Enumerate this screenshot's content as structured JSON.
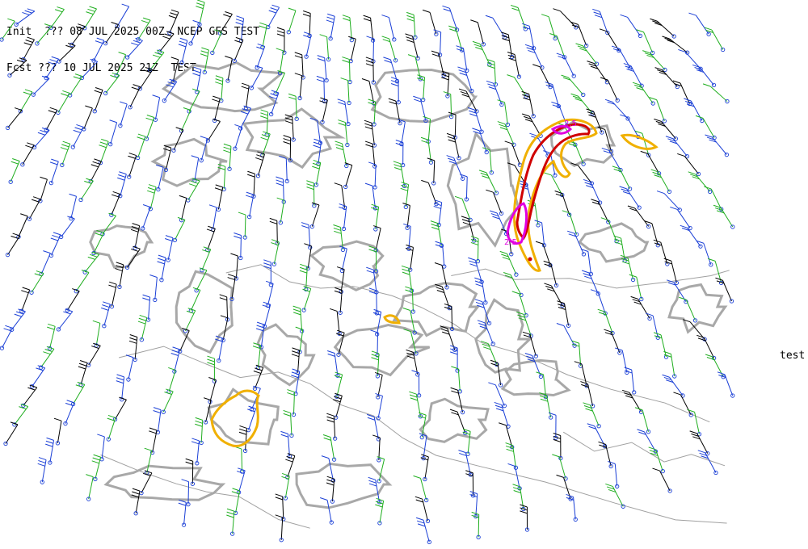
{
  "header": {
    "init_line": "Init  ??? 08 JUL 2025 00Z  NCEP GFS TEST",
    "fcst_line": "Fcst ??? 10 JUL 2025 21Z  TEST"
  },
  "side_label": "test",
  "map": {
    "projection": "polar-stereographic",
    "layers": [
      "wind-barbs",
      "gray-contours",
      "coastlines",
      "highlight-contours"
    ]
  },
  "contour_labels": [
    "2.5",
    "2.5"
  ],
  "colors": {
    "background": "#ffffff",
    "coastline": "#a0a0a0",
    "gray_contour": "#a8a8a8",
    "barb_black": "#000000",
    "barb_blue": "#1a3fd6",
    "barb_green": "#1fae1f",
    "station_circle": "#1a3fd6",
    "contour_orange": "#f0b000",
    "contour_red": "#d00000",
    "contour_magenta": "#e000e0"
  }
}
